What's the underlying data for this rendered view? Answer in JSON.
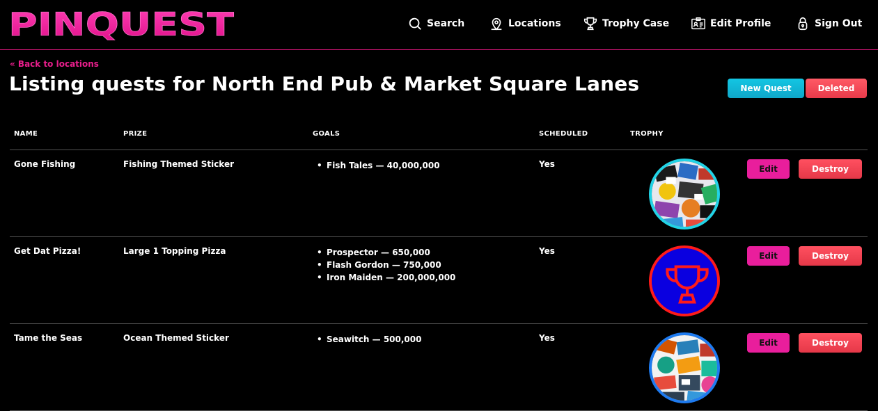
{
  "brand": {
    "name": "PINQUEST",
    "accent": "#e91e8c"
  },
  "nav": [
    {
      "label": "Search",
      "icon": "search-icon"
    },
    {
      "label": "Locations",
      "icon": "map-pin-icon"
    },
    {
      "label": "Trophy Case",
      "icon": "trophy-icon"
    },
    {
      "label": "Edit Profile",
      "icon": "id-card-icon"
    },
    {
      "label": "Sign Out",
      "icon": "lock-icon"
    }
  ],
  "back_link": "« Back to locations",
  "title": "Listing quests for North End Pub & Market Square Lanes",
  "actions": {
    "new_quest": "New Quest",
    "deleted": "Deleted"
  },
  "table": {
    "headers": [
      "NAME",
      "PRIZE",
      "GOALS",
      "SCHEDULED",
      "TROPHY"
    ],
    "rows": [
      {
        "name": "Gone Fishing",
        "prize": "Fishing Themed Sticker",
        "goals": [
          "Fish Tales — 40,000,000"
        ],
        "scheduled": "Yes",
        "trophy": "sticker-collage-image",
        "trophy_ring": "#22d3e6",
        "edit": "Edit",
        "destroy": "Destroy"
      },
      {
        "name": "Get Dat Pizza!",
        "prize": "Large 1 Topping Pizza",
        "goals": [
          "Prospector — 650,000",
          "Flash Gordon — 750,000",
          "Iron Maiden — 200,000,000"
        ],
        "scheduled": "Yes",
        "trophy": "trophy-icon",
        "trophy_ring": "#ff1a1a",
        "edit": "Edit",
        "destroy": "Destroy"
      },
      {
        "name": "Tame the Seas",
        "prize": "Ocean Themed Sticker",
        "goals": [
          "Seawitch — 500,000"
        ],
        "scheduled": "Yes",
        "trophy": "sticker-collage-image",
        "trophy_ring": "#1e7bf0",
        "edit": "Edit",
        "destroy": "Destroy"
      }
    ]
  }
}
